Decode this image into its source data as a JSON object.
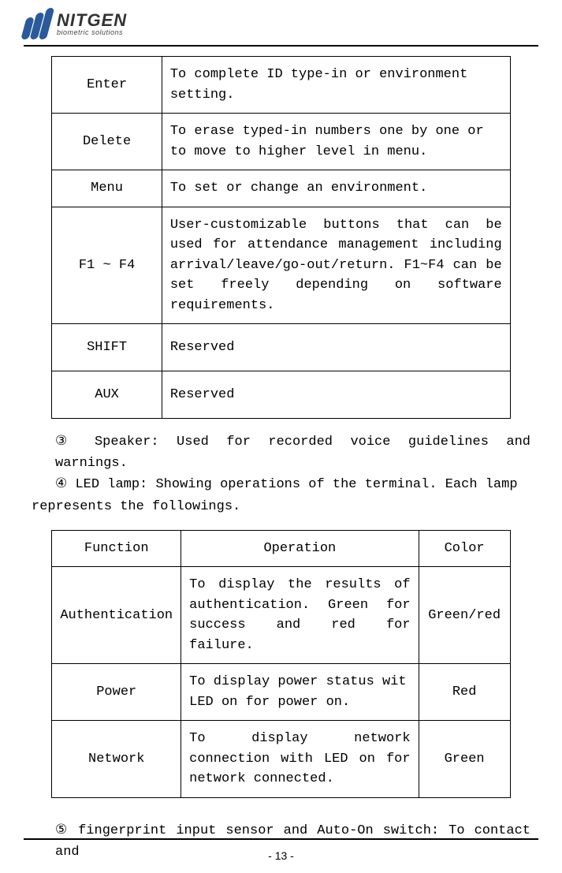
{
  "header": {
    "brand": "NITGEN",
    "subtitle": "biometric solutions"
  },
  "table1": {
    "rows": [
      {
        "key": "Enter",
        "desc": "To complete ID type-in or environment setting."
      },
      {
        "key": "Delete",
        "desc": "To erase typed-in numbers one by one or to move to higher level in menu."
      },
      {
        "key": "Menu",
        "desc": "To set or change an environment."
      },
      {
        "key": "F1 ~ F4",
        "desc": "User-customizable buttons that can be used for attendance management including arrival/leave/go-out/return. F1~F4 can be set freely depending on software requirements."
      },
      {
        "key": "SHIFT",
        "desc": "Reserved"
      },
      {
        "key": "AUX",
        "desc": "Reserved"
      }
    ]
  },
  "paragraphs": {
    "p3": "③ Speaker: Used for recorded voice guidelines and warnings.",
    "p4a": "④ LED lamp: Showing operations of the terminal. Each lamp",
    "p4b": "represents the followings.",
    "p5": "⑤ fingerprint input sensor and Auto-On switch: To contact and"
  },
  "table2": {
    "headers": {
      "c1": "Function",
      "c2": "Operation",
      "c3": "Color"
    },
    "rows": [
      {
        "fn": "Authentication",
        "op": "To display the results of authentication. Green for success and red for failure.",
        "col": "Green/red"
      },
      {
        "fn": "Power",
        "op": "To display power status wit LED on for power on.",
        "col": "Red"
      },
      {
        "fn": "Network",
        "op": "To display network connection with LED on for network connected.",
        "col": "Green"
      }
    ]
  },
  "page_number": "- 13 -"
}
